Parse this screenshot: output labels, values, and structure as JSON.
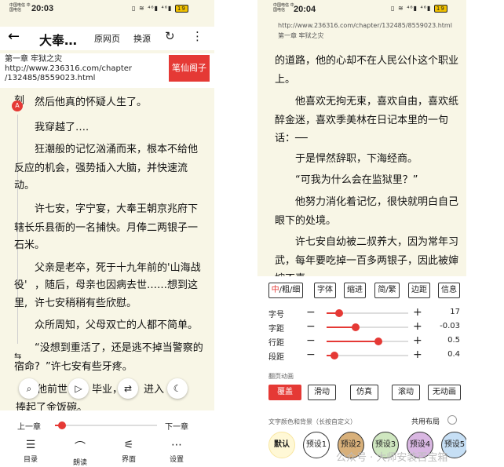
{
  "left": {
    "status": {
      "carrier": "中国电信 中国电信",
      "time": "20:03",
      "icons": "▯ ≋ ⁴⁶▮ ⁴⁶▮",
      "battery": "19"
    },
    "toolbar": {
      "title": "大奉…",
      "web_page": "原网页",
      "change_source": "换源",
      "refresh": "↻",
      "more": "⋮",
      "back": "←"
    },
    "chapter": {
      "name": "第一章 牢狱之灾",
      "url1": "http://www.236316.com/chapter",
      "url2": "/132485/8559023.html"
    },
    "source_button": "笔仙阁子",
    "side_chars": [
      "刻",
      "反应",
      "动。",
      "辖长",
      "石米。",
      "役'",
      "里,",
      "宿命?"
    ],
    "lines": [
      "然后他真的怀疑人生了。",
      "我穿越了….",
      "狂潮般的记忆汹涌而来，根本不给他",
      "的机会，强势插入大脑，并快速流",
      "许七安，字宁宴，大奉王朝京兆府下",
      "乐县衙的一名捕快。月俸二两银子一",
      "父亲是老卒，死于十九年前的'山海战",
      "，随后，母亲也因病去世……想到这",
      "许七安稍稍有些欣慰。",
      "众所周知，父母双亡的人都不简单。",
      "“没想到重活了，还是逃不掉当警察的",
      "”许七安有些牙疼。",
      "他前世",
      "毕业，",
      "进入",
      "捧起了金饭碗。"
    ],
    "progress": {
      "prev": "上一章",
      "next": "下一章",
      "value": 0.07
    },
    "nav": [
      {
        "icon": "☰",
        "label": "目录"
      },
      {
        "icon": "⌒",
        "label": "朗读"
      },
      {
        "icon": "⚟",
        "label": "界面"
      },
      {
        "icon": "⋯",
        "label": "设置"
      }
    ]
  },
  "right": {
    "status": {
      "carrier": "中国电信 中国电信",
      "time": "20:04",
      "icons": "▯ ≋ ⁴⁶▮ ⁴⁶▮",
      "battery": "19"
    },
    "header": {
      "url": "http://www.236316.com/chapter/132485/8559023.html",
      "chapter": "第一章 牢狱之灾"
    },
    "lines": [
      "的道路，他的心却不在人民公仆这个职业",
      "上。",
      "他喜欢无拘无束，喜欢自由，喜欢纸",
      "醉金迷，喜欢季美林在日记本里的一句",
      "话：──",
      "于是悍然辞职，下海经商。",
      "“可我为什么会在监狱里？”",
      "他努力消化着记忆，很快就明白自己",
      "眼下的处境。",
      "许七安自幼被二叔养大，因为常年习",
      "武，每年要吃掉一百多两银子，因此被婶",
      "婶不喜"
    ],
    "tabs": [
      "中/粗/细",
      "字体",
      "缩进",
      "简/繁",
      "边距",
      "信息"
    ],
    "sliders": [
      {
        "label": "字号",
        "value": "17",
        "frac": 0.15
      },
      {
        "label": "字距",
        "value": "-0.03",
        "frac": 0.36
      },
      {
        "label": "行距",
        "value": "0.5",
        "frac": 0.63
      },
      {
        "label": "段距",
        "value": "0.4",
        "frac": 0.1
      }
    ],
    "anim_title": "翻页动画",
    "anims": [
      "覆盖",
      "滑动",
      "仿真",
      "滚动",
      "无动画"
    ],
    "color_title": "文字颜色和背景（长按自定义）",
    "shared_layout": "共用布局",
    "presets": [
      "默认",
      "预设1",
      "预设2",
      "预设3",
      "预设4",
      "预设5"
    ],
    "preset_colors": [
      "#fff8d6",
      "#ffffff",
      "#d8b07a",
      "#cfe7c0",
      "#d9b7e2",
      "#c6dff5"
    ]
  },
  "watermark": "公众号 · 大师安装百宝箱",
  "colors": {
    "accent": "#e53935",
    "paper": "#f8f6e6"
  }
}
